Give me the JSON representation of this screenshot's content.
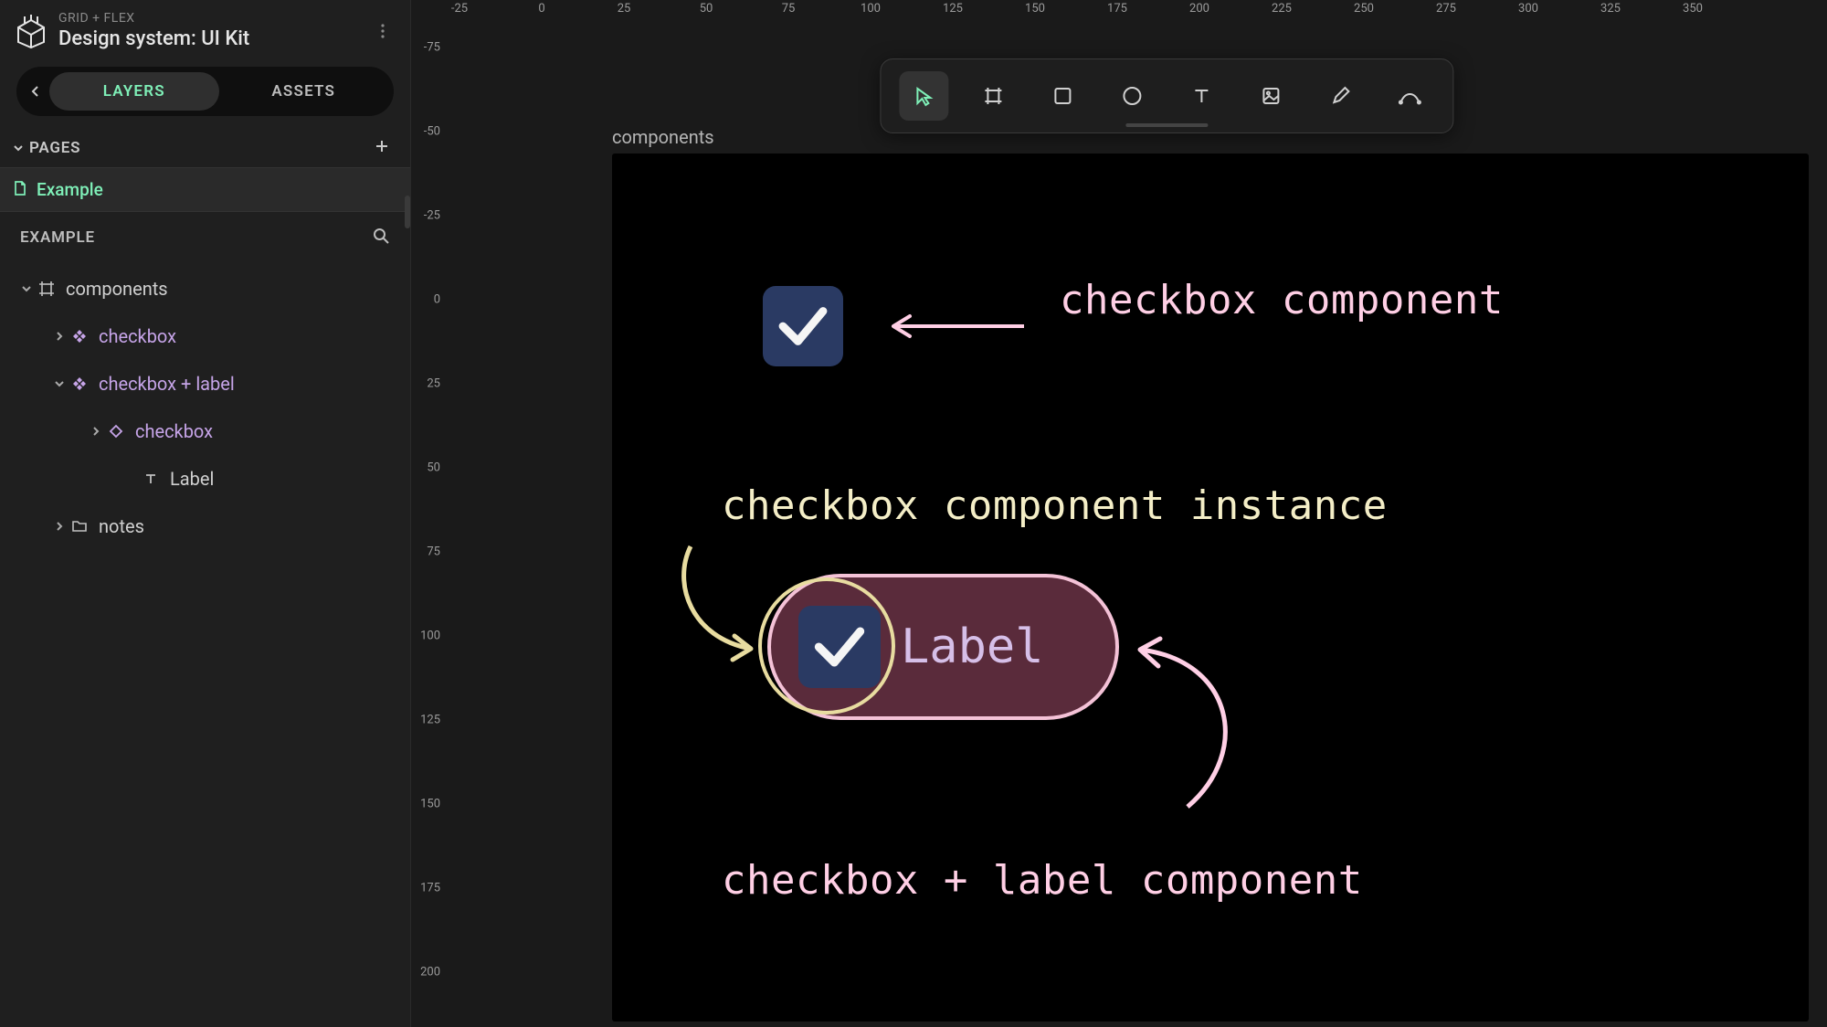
{
  "project": {
    "breadcrumb": "GRID + FLEX",
    "title": "Design system: UI Kit"
  },
  "tabs": {
    "layers": "LAYERS",
    "assets": "ASSETS",
    "active": "layers"
  },
  "pages": {
    "header": "PAGES",
    "items": [
      {
        "name": "Example",
        "active": true
      }
    ]
  },
  "section_header": "EXAMPLE",
  "layers": [
    {
      "id": "components",
      "name": "components",
      "depth": 0,
      "type": "frame",
      "expanded": true
    },
    {
      "id": "checkbox-main",
      "name": "checkbox",
      "depth": 1,
      "type": "component",
      "expanded": false
    },
    {
      "id": "checkbox-label",
      "name": "checkbox + label",
      "depth": 1,
      "type": "component",
      "expanded": true
    },
    {
      "id": "checkbox-instance",
      "name": "checkbox",
      "depth": 2,
      "type": "instance",
      "expanded": false
    },
    {
      "id": "label-text",
      "name": "Label",
      "depth": 3,
      "type": "text",
      "expanded": null
    },
    {
      "id": "notes",
      "name": "notes",
      "depth": 1,
      "type": "folder",
      "expanded": false
    }
  ],
  "ruler": {
    "h_ticks": [
      -25,
      0,
      25,
      50,
      75,
      100,
      125,
      150,
      175,
      200,
      225,
      250,
      275,
      300,
      325,
      350
    ],
    "v_ticks": [
      -75,
      -50,
      -25,
      0,
      25,
      50,
      75,
      100,
      125,
      150,
      175,
      200
    ]
  },
  "canvas": {
    "frame_label": "components",
    "annotations": {
      "checkbox_component": "checkbox component",
      "instance": "checkbox component instance",
      "combo": "checkbox + label component",
      "pill_label": "Label"
    }
  },
  "toolbar": {
    "tools": [
      "select",
      "frame",
      "rectangle",
      "ellipse",
      "text",
      "image",
      "pencil",
      "pen"
    ],
    "active": "select"
  }
}
